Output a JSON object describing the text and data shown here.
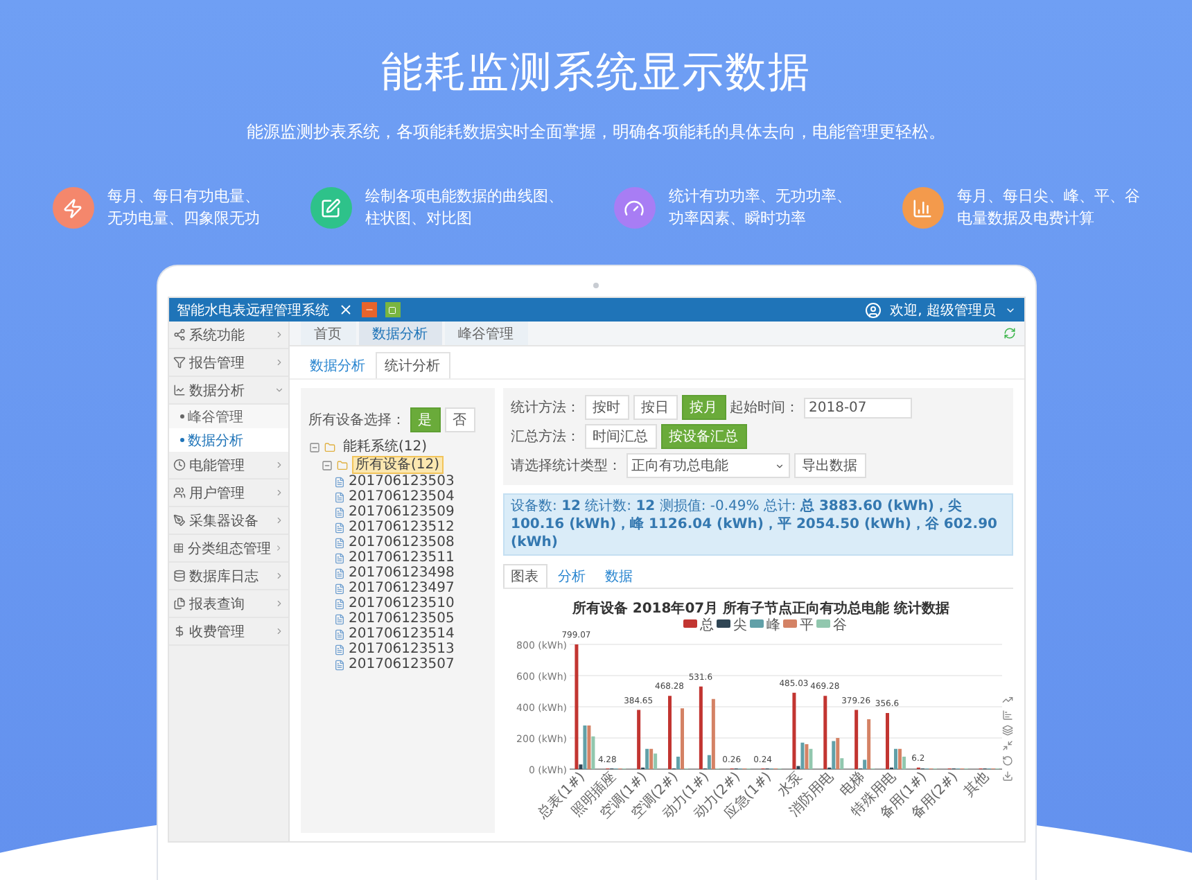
{
  "hero": {
    "title": "能耗监测系统显示数据",
    "subtitle": "能源监测抄表系统，各项能耗数据实时全面掌握，明确各项能耗的具体去向，电能管理更轻松。"
  },
  "features": [
    {
      "kind": "bolt",
      "color": "#f4876c",
      "lines": [
        "每月、每日有功电量、",
        "无功电量、四象限无功"
      ]
    },
    {
      "kind": "edit",
      "color": "#2ec28a",
      "lines": [
        "绘制各项电能数据的曲线图、",
        "柱状图、对比图"
      ]
    },
    {
      "kind": "gauge",
      "color": "#a87df4",
      "lines": [
        "统计有功功率、无功功率、",
        "功率因素、瞬时功率"
      ]
    },
    {
      "kind": "chart",
      "color": "#f39a4c",
      "lines": [
        "每月、每日尖、峰、平、谷",
        "电量数据及电费计算"
      ]
    }
  ],
  "app": {
    "title": "智能水电表远程管理系统",
    "user": "欢迎, 超级管理员",
    "sidebar": [
      {
        "label": "系统功能",
        "expanded": false
      },
      {
        "label": "报告管理",
        "expanded": false
      },
      {
        "label": "数据分析",
        "expanded": true,
        "children": [
          {
            "label": "峰谷管理",
            "selected": false
          },
          {
            "label": "数据分析",
            "selected": true
          }
        ]
      },
      {
        "label": "电能管理",
        "expanded": false
      },
      {
        "label": "用户管理",
        "expanded": false
      },
      {
        "label": "采集器设备",
        "expanded": false
      },
      {
        "label": "分类组态管理",
        "expanded": false
      },
      {
        "label": "数据库日志",
        "expanded": false
      },
      {
        "label": "报表查询",
        "expanded": false
      },
      {
        "label": "收费管理",
        "expanded": false
      }
    ],
    "tabs": [
      {
        "label": "首页",
        "selected": false
      },
      {
        "label": "数据分析",
        "selected": true
      },
      {
        "label": "峰谷管理",
        "selected": false
      }
    ],
    "subtabs": [
      {
        "label": "数据分析",
        "selected": false
      },
      {
        "label": "统计分析",
        "selected": true
      }
    ],
    "device_select": {
      "label": "所有设备选择：",
      "options": [
        {
          "label": "是",
          "selected": true
        },
        {
          "label": "否",
          "selected": false
        }
      ]
    },
    "tree": [
      {
        "label": "能耗系统(12)",
        "expanded": true,
        "selected": false,
        "children": [
          {
            "label": "所有设备(12)",
            "expanded": true,
            "selected": true,
            "children": [
              {
                "label": "201706123503"
              },
              {
                "label": "201706123504"
              },
              {
                "label": "201706123509"
              },
              {
                "label": "201706123512"
              },
              {
                "label": "201706123508"
              },
              {
                "label": "201706123511"
              },
              {
                "label": "201706123498"
              },
              {
                "label": "201706123497"
              },
              {
                "label": "201706123510"
              },
              {
                "label": "201706123505"
              },
              {
                "label": "201706123514"
              },
              {
                "label": "201706123513"
              },
              {
                "label": "201706123507"
              }
            ]
          }
        ]
      }
    ],
    "stat_method": {
      "label": "统计方法：",
      "options": [
        {
          "label": "按时",
          "selected": false
        },
        {
          "label": "按日",
          "selected": false
        },
        {
          "label": "按月",
          "selected": true
        }
      ]
    },
    "start_time": {
      "label": "起始时间：",
      "value": "2018-07"
    },
    "summary_method": {
      "label": "汇总方法：",
      "options": [
        {
          "label": "时间汇总",
          "selected": false
        },
        {
          "label": "按设备汇总",
          "selected": true
        }
      ]
    },
    "stat_type": {
      "label": "请选择统计类型：",
      "value": "正向有功总电能"
    },
    "export_button": "导出数据",
    "summary": "设备数: **12** 统计数: **12** 测损值: -0.49% 总计: **总 3883.60 (kWh)，尖 100.16 (kWh)，峰 1126.04 (kWh)，平 2054.50 (kWh)，谷 602.90 (kWh)**",
    "chart_tabs": [
      {
        "label": "图表",
        "selected": true
      },
      {
        "label": "分析",
        "selected": false
      },
      {
        "label": "数据",
        "selected": false
      }
    ],
    "chart_data": {
      "type": "bar",
      "title": "所有设备 2018年07月 所有子节点正向有功总电能 统计数据",
      "categories": [
        "总表(1#)",
        "照明插座",
        "空调(1#)",
        "空调(2#)",
        "动力(1#)",
        "动力(2#)",
        "应急(1#)",
        "水泵",
        "消防用电",
        "电梯",
        "特殊用电",
        "备用(1#)",
        "备用(2#)",
        "其他"
      ],
      "series": [
        {
          "name": "总",
          "color": "#c23531",
          "values": [
            800,
            0,
            380,
            470,
            530,
            0,
            0,
            490,
            470,
            380,
            360,
            10,
            0,
            0
          ]
        },
        {
          "name": "尖",
          "color": "#2f4554",
          "values": [
            30,
            0,
            10,
            0,
            0,
            0,
            0,
            20,
            10,
            0,
            10,
            0,
            0,
            0
          ]
        },
        {
          "name": "峰",
          "color": "#61a0a8",
          "values": [
            280,
            0,
            130,
            80,
            90,
            0,
            0,
            170,
            180,
            60,
            130,
            0,
            0,
            0
          ]
        },
        {
          "name": "平",
          "color": "#d48265",
          "values": [
            280,
            0,
            130,
            390,
            450,
            0,
            0,
            160,
            200,
            320,
            130,
            0,
            0,
            0
          ]
        },
        {
          "name": "谷",
          "color": "#91c7ae",
          "values": [
            210,
            0,
            100,
            0,
            0,
            0,
            0,
            130,
            70,
            0,
            80,
            0,
            0,
            0
          ]
        }
      ],
      "grid": true,
      "legend": true,
      "value_labels": [
        "799.07",
        "4.28",
        "384.65",
        "468.28",
        "531.6",
        "0.26",
        "0.24",
        "485.03",
        "469.28",
        "379.26",
        "356.6",
        "6.2",
        null,
        null
      ],
      "ylim": [
        0,
        800
      ],
      "yticks": [
        {
          "value": 0,
          "label": "0 (kWh)"
        },
        {
          "value": 200,
          "label": "200 (kWh)"
        },
        {
          "value": 400,
          "label": "400 (kWh)"
        },
        {
          "value": 600,
          "label": "600 (kWh)"
        },
        {
          "value": 800,
          "label": "800 (kWh)"
        }
      ]
    }
  }
}
